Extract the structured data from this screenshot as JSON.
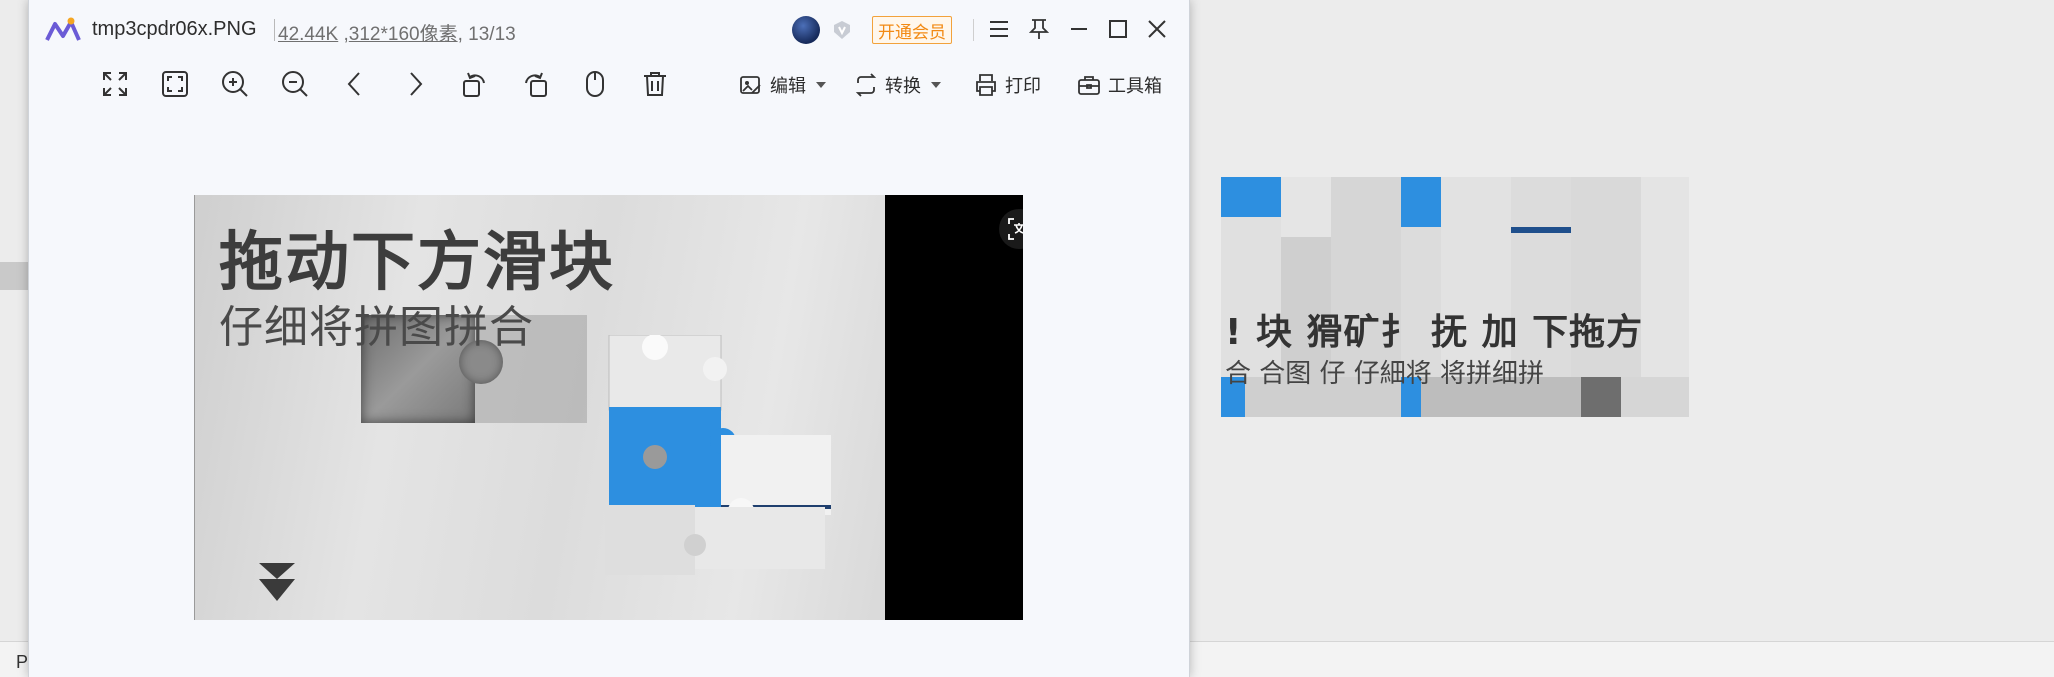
{
  "window": {
    "file_name": "tmp3cpdr06x.PNG",
    "file_size": "42.44K",
    "dimensions": "312*160像素",
    "position": ", 13/13",
    "vip_label": "开通会员"
  },
  "toolbar": {
    "edit_label": "编辑",
    "convert_label": "转换",
    "print_label": "打印",
    "toolbox_label": "工具箱"
  },
  "image": {
    "title": "拖动下方滑块",
    "subtitle": "仔细将拼图拼合"
  },
  "strip": {
    "title_fragment": "! 块 "
  },
  "background": {
    "bottom_left_letter": "P"
  },
  "colors": {
    "accent": "#f28a14",
    "viewer_bg": "#f6f8fc",
    "puzzle_blue": "#2d8fe0"
  }
}
